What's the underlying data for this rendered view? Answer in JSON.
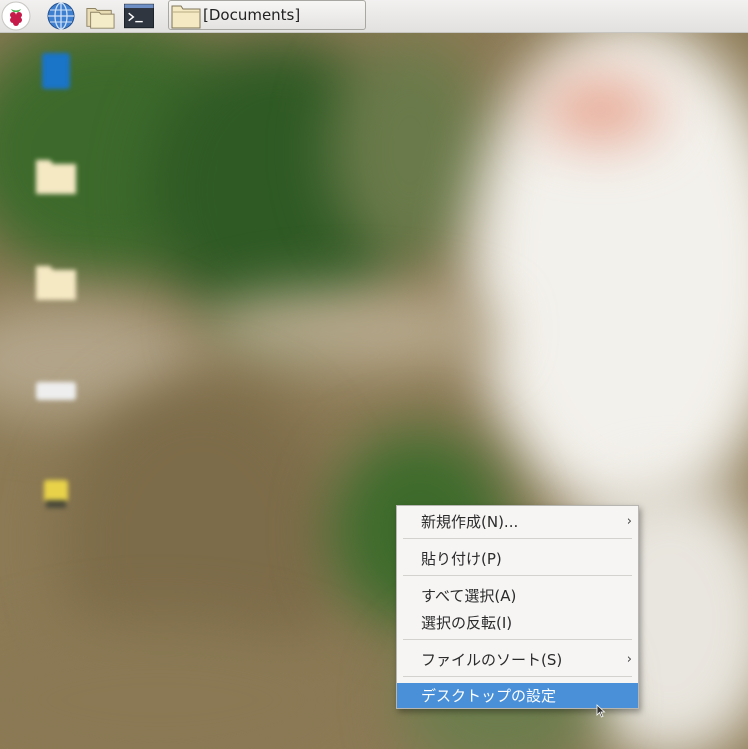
{
  "taskbar": {
    "launchers": [
      {
        "icon": "raspberry-menu-icon"
      },
      {
        "icon": "web-browser-icon"
      },
      {
        "icon": "file-manager-icon"
      },
      {
        "icon": "terminal-icon"
      }
    ],
    "task_button_label": "[Documents]"
  },
  "desktop": {
    "icons": [
      {
        "icon": "trash-icon",
        "caption": ""
      },
      {
        "icon": "folder-icon",
        "caption": ""
      },
      {
        "icon": "folder-icon",
        "caption": ""
      },
      {
        "icon": "drive-icon",
        "caption": ""
      },
      {
        "icon": "usb-drive-icon",
        "caption": ""
      }
    ]
  },
  "context_menu": {
    "items": [
      {
        "label": "新規作成(N)...",
        "submenu": true
      },
      {
        "label": "貼り付け(P)",
        "submenu": false
      },
      {
        "label": "すべて選択(A)",
        "submenu": false
      },
      {
        "label": "選択の反転(I)",
        "submenu": false
      },
      {
        "label": "ファイルのソート(S)",
        "submenu": true
      },
      {
        "label": "デスクトップの設定",
        "submenu": false,
        "highlighted": true
      }
    ],
    "arrow_glyph": "›",
    "highlight_color": "#4a90d9"
  }
}
